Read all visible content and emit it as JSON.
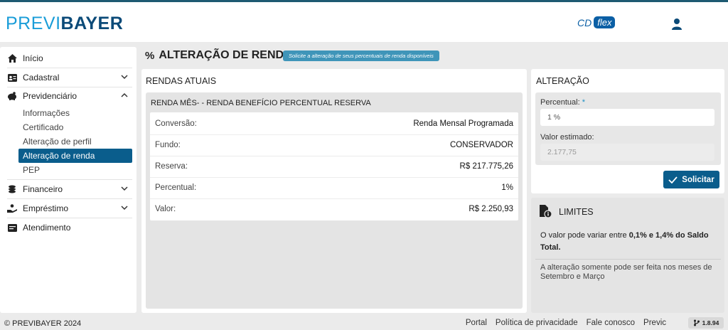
{
  "brand": {
    "logo_light": "PREVI",
    "logo_bold": "BAYER",
    "product_prefix": "CD",
    "product_badge": "flex"
  },
  "sidebar": {
    "items": [
      {
        "label": "Início",
        "icon": "home-icon"
      },
      {
        "label": "Cadastral",
        "icon": "id-card-icon"
      },
      {
        "label": "Previdenciário",
        "icon": "piggy-bank-icon"
      },
      {
        "label": "Financeiro",
        "icon": "coins-icon"
      },
      {
        "label": "Empréstimo",
        "icon": "hand-coin-icon"
      },
      {
        "label": "Atendimento",
        "icon": "chat-icon"
      }
    ],
    "sub_items": [
      "Informações",
      "Certificado",
      "Alteração de perfil",
      "Alteração de renda",
      "PEP"
    ],
    "active_sub": "Alteração de renda"
  },
  "page": {
    "title": "ALTERAÇÃO DE RENDA",
    "tag": "Solicite a alteração de seus percentuais de renda disponíveis"
  },
  "rendas": {
    "title": "RENDAS ATUAIS",
    "subtitle": "RENDA MÊS- - RENDA BENEFÍCIO PERCENTUAL RESERVA",
    "rows": [
      {
        "label": "Conversão:",
        "value": "Renda Mensal Programada"
      },
      {
        "label": "Fundo:",
        "value": "CONSERVADOR"
      },
      {
        "label": "Reserva:",
        "value": "R$ 217.775,26"
      },
      {
        "label": "Percentual:",
        "value": "1%"
      },
      {
        "label": "Valor:",
        "value": "R$ 2.250,93"
      }
    ]
  },
  "alteracao": {
    "title": "ALTERAÇÃO",
    "percentual_label": "Percentual:",
    "required_mark": "*",
    "percentual_value": "1 %",
    "estimado_label": "Valor estimado:",
    "estimado_value": "2.177,75",
    "button_label": "Solicitar"
  },
  "limites": {
    "title": "LIMITES",
    "text_prefix": "O valor pode variar entre ",
    "text_bold": "0,1% e 1,4% do Saldo Total.",
    "note": "A alteração somente pode ser feita nos meses de Setembro e Março"
  },
  "footer": {
    "copyright": "© PREVIBAYER 2024",
    "links": [
      "Portal",
      "Política de privacidade",
      "Fale conosco",
      "Previc"
    ],
    "version": "1.8.94"
  },
  "colors": {
    "primary": "#0a5d8c",
    "accent": "#1a9dd8",
    "tag": "#3f95b9"
  }
}
